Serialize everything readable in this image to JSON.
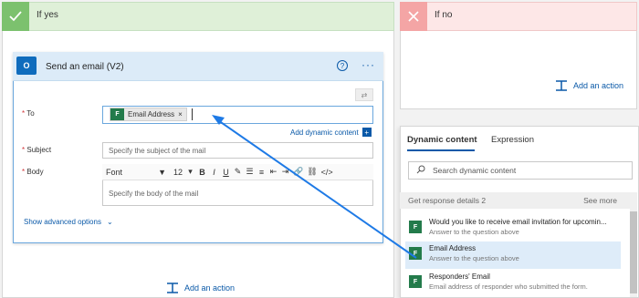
{
  "yes_branch": {
    "title": "If yes"
  },
  "no_branch": {
    "title": "If no",
    "add_action": "Add an action"
  },
  "action_card": {
    "title": "Send an email (V2)",
    "help": "?",
    "more": "···",
    "to_label": "To",
    "to_token": "Email Address",
    "to_token_remove": "×",
    "add_dynamic_label": "Add dynamic content",
    "subject_label": "Subject",
    "subject_placeholder": "Specify the subject of the mail",
    "body_label": "Body",
    "body_placeholder": "Specify the body of the mail",
    "toolbar": {
      "font": "Font",
      "size": "12",
      "bold": "B",
      "italic": "I",
      "underline": "U"
    },
    "show_advanced": "Show advanced options",
    "required_marker": "*"
  },
  "add_action_bottom": "Add an action",
  "dynamic_panel": {
    "tabs": [
      "Dynamic content",
      "Expression"
    ],
    "search_placeholder": "Search dynamic content",
    "section_title": "Get response details 2",
    "see_more": "See more",
    "items": [
      {
        "title": "Would you like to receive email invitation for upcomin...",
        "desc": "Answer to the question above"
      },
      {
        "title": "Email Address",
        "desc": "Answer to the question above"
      },
      {
        "title": "Responders' Email",
        "desc": "Email address of responder who submitted the form."
      }
    ]
  },
  "colors": {
    "accent": "#0a59a8",
    "yes": "#7cc16e",
    "no": "#f4a5a5",
    "forms": "#237b4b",
    "arrow": "#1e7ae6"
  }
}
